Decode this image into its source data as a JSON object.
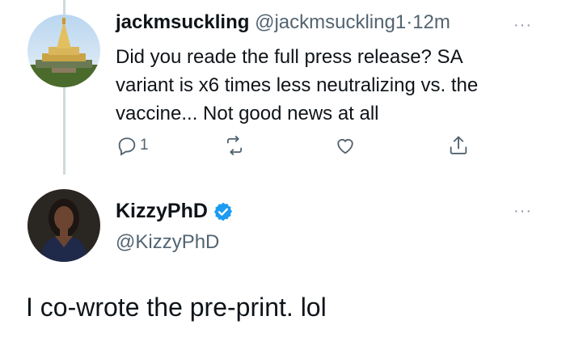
{
  "tweet1": {
    "display_name": "jackmsuckling",
    "handle": "@jackmsuckling1",
    "separator": "·",
    "time": "12m",
    "text_line1": "Did you reade the full press release? SA",
    "text_line2": "variant is x6 times less neutralizing vs. the",
    "text_line3": "vaccine... Not good news at all",
    "reply_count": "1",
    "more": "···"
  },
  "tweet2": {
    "display_name": "KizzyPhD",
    "handle": "@KizzyPhD",
    "text": "I co-wrote the pre-print. lol",
    "more": "···"
  },
  "colors": {
    "text": "#0f1419",
    "secondary": "#536471",
    "verified": "#1d9bf0",
    "thread_line": "#cfd9de"
  },
  "icons": [
    "reply-icon",
    "retweet-icon",
    "like-icon",
    "share-icon",
    "verified-badge-icon",
    "more-icon"
  ]
}
